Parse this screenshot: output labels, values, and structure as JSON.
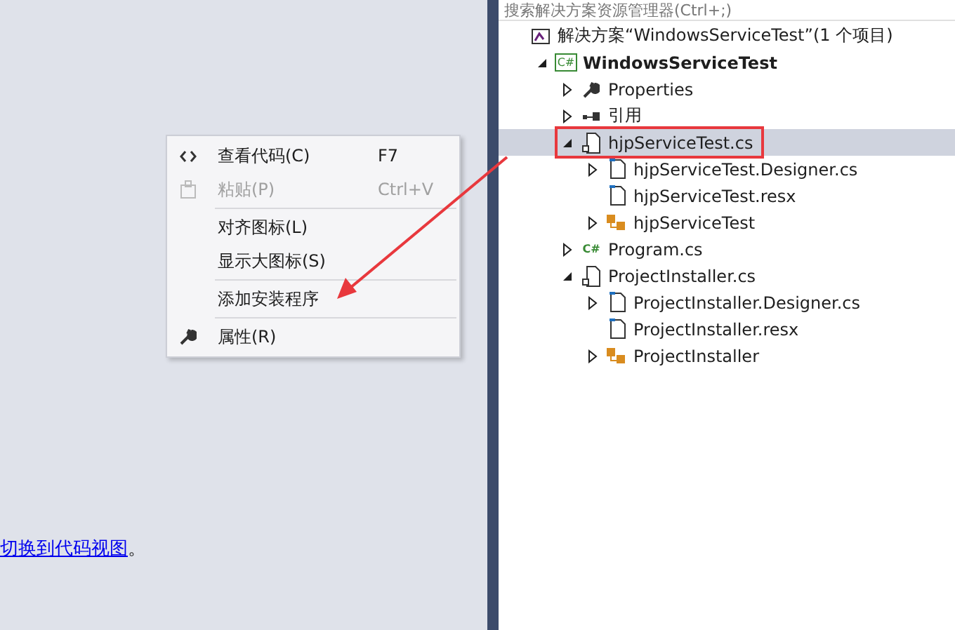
{
  "designer": {
    "link_sentence": {
      "link": "切换到代码视图",
      "after": "。"
    }
  },
  "context_menu": {
    "items": [
      {
        "kind": "code",
        "label": "查看代码(C)",
        "shortcut": "F7",
        "disabled": false
      },
      {
        "kind": "paste",
        "label": "粘贴(P)",
        "shortcut": "Ctrl+V",
        "disabled": true
      },
      {
        "kind": "separator"
      },
      {
        "kind": "plain",
        "label": "对齐图标(L)",
        "disabled": false
      },
      {
        "kind": "plain",
        "label": "显示大图标(S)",
        "disabled": false
      },
      {
        "kind": "separator"
      },
      {
        "kind": "plain",
        "label": "添加安装程序",
        "disabled": false
      },
      {
        "kind": "separator"
      },
      {
        "kind": "wrench",
        "label": "属性(R)",
        "disabled": false
      }
    ]
  },
  "solution_explorer": {
    "search": {
      "placeholder": "搜索解决方案资源管理器(Ctrl+;)"
    },
    "tree": [
      {
        "label": "解决方案“WindowsServiceTest”(1 个项目)",
        "kind": "solution",
        "selected": false,
        "children": [
          {
            "label": "WindowsServiceTest",
            "kind": "project",
            "icon_text": "C#",
            "bold": true,
            "expanded": true,
            "selected": false,
            "children": [
              {
                "label": "Properties",
                "kind": "wrench",
                "expanded": false,
                "selected": false
              },
              {
                "label": "引用",
                "kind": "references",
                "expanded": false,
                "selected": false
              },
              {
                "label": "hjpServiceTest.cs",
                "kind": "code-file",
                "expanded": true,
                "selected": true,
                "callout": true,
                "children": [
                  {
                    "label": "hjpServiceTest.Designer.cs",
                    "kind": "document",
                    "expanded": false,
                    "selected": false
                  },
                  {
                    "label": "hjpServiceTest.resx",
                    "kind": "document",
                    "selected": false
                  },
                  {
                    "label": "hjpServiceTest",
                    "kind": "component",
                    "expanded": false,
                    "selected": false
                  }
                ]
              },
              {
                "label": "Program.cs",
                "kind": "csharp",
                "icon_text": "C#",
                "expanded": false,
                "selected": false
              },
              {
                "label": "ProjectInstaller.cs",
                "kind": "code-file",
                "expanded": true,
                "selected": false,
                "children": [
                  {
                    "label": "ProjectInstaller.Designer.cs",
                    "kind": "document",
                    "expanded": false,
                    "selected": false
                  },
                  {
                    "label": "ProjectInstaller.resx",
                    "kind": "document",
                    "selected": false
                  },
                  {
                    "label": "ProjectInstaller",
                    "kind": "component",
                    "expanded": false,
                    "selected": false
                  }
                ]
              }
            ]
          }
        ]
      }
    ]
  },
  "annotation_arrow": true
}
